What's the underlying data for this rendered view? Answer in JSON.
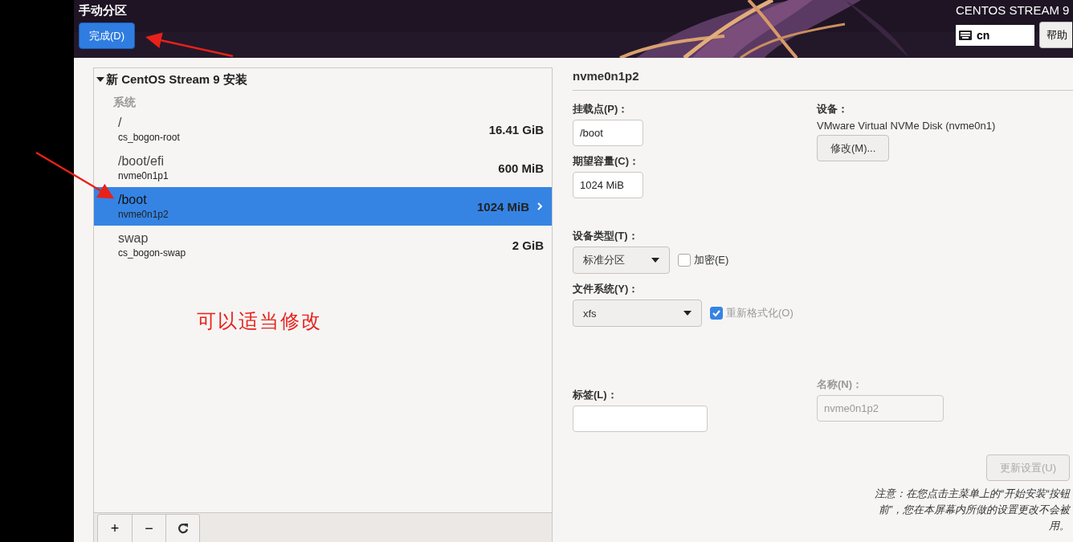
{
  "header": {
    "title": "手动分区",
    "done_button": "完成(D)",
    "product": "CENTOS STREAM 9",
    "keyboard_layout": "cn",
    "help_button": "帮助"
  },
  "partition_tree": {
    "label": "新 CentOS Stream 9 安装",
    "expanded": true,
    "group": "系统",
    "items": [
      {
        "mount": "/",
        "device": "cs_bogon-root",
        "size": "16.41 GiB",
        "selected": false
      },
      {
        "mount": "/boot/efi",
        "device": "nvme0n1p1",
        "size": "600 MiB",
        "selected": false
      },
      {
        "mount": "/boot",
        "device": "nvme0n1p2",
        "size": "1024 MiB",
        "selected": true
      },
      {
        "mount": "swap",
        "device": "cs_bogon-swap",
        "size": "2 GiB",
        "selected": false
      }
    ]
  },
  "toolbar": [
    {
      "kind": "add",
      "label": "+"
    },
    {
      "kind": "remove",
      "label": "−"
    },
    {
      "kind": "refresh"
    }
  ],
  "annotation": {
    "note": "可以适当修改"
  },
  "details": {
    "title": "nvme0n1p2",
    "mount_point": {
      "label": "挂载点(P)：",
      "value": "/boot"
    },
    "capacity": {
      "label": "期望容量(C)：",
      "value": "1024 MiB"
    },
    "device": {
      "label": "设备：",
      "value": "VMware Virtual NVMe Disk (nvme0n1)",
      "button": "修改(M)..."
    },
    "device_type": {
      "label": "设备类型(T)：",
      "value": "标准分区"
    },
    "encrypt": {
      "label": "加密(E)",
      "checked": false,
      "disabled": false
    },
    "file_system": {
      "label": "文件系统(Y)：",
      "value": "xfs"
    },
    "reformat": {
      "label": "重新格式化(O)",
      "checked": true,
      "disabled": true
    },
    "tag": {
      "label": "标签(L)："
    },
    "name": {
      "label": "名称(N)：",
      "value": "nvme0n1p2",
      "disabled": true
    },
    "update_button": {
      "label": "更新设置(U)",
      "disabled": true
    },
    "note_lines": [
      "注意：在您点击主菜单上的“开始安装“按钮",
      "前”，您在本屏幕内所做的设置更改不会被",
      "用。"
    ]
  }
}
